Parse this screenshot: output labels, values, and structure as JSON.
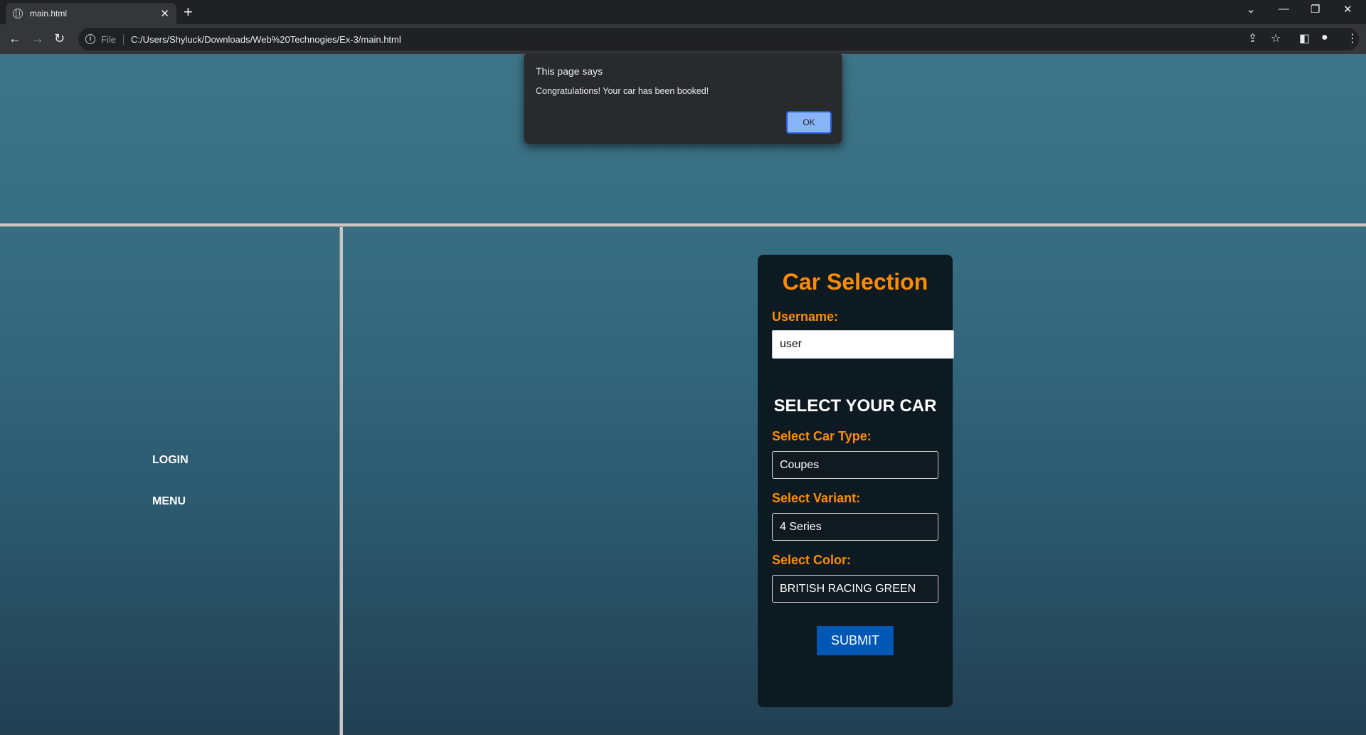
{
  "browser": {
    "tab_title": "main.html",
    "tab_close": "✕",
    "new_tab": "+",
    "file_label": "File",
    "url": "C:/Users/Shyluck/Downloads/Web%20Technogies/Ex-3/main.html"
  },
  "alert": {
    "title": "This page says",
    "message": "Congratulations! Your car has been booked!",
    "ok_label": "OK"
  },
  "sidebar": {
    "items": [
      {
        "label": "LOGIN"
      },
      {
        "label": "MENU"
      }
    ]
  },
  "form": {
    "title": "Car Selection",
    "username_label": "Username:",
    "username_value": "user",
    "section_heading": "SELECT YOUR CAR",
    "car_type_label": "Select Car Type:",
    "car_type_value": "Coupes",
    "variant_label": "Select Variant:",
    "variant_value": "4 Series",
    "color_label": "Select Color:",
    "color_value": "BRITISH RACING GREEN",
    "submit_label": "SUBMIT"
  },
  "colors": {
    "accent_orange": "#ff8c00",
    "submit_blue": "#0058b4",
    "card_bg": "#0e1a22"
  }
}
